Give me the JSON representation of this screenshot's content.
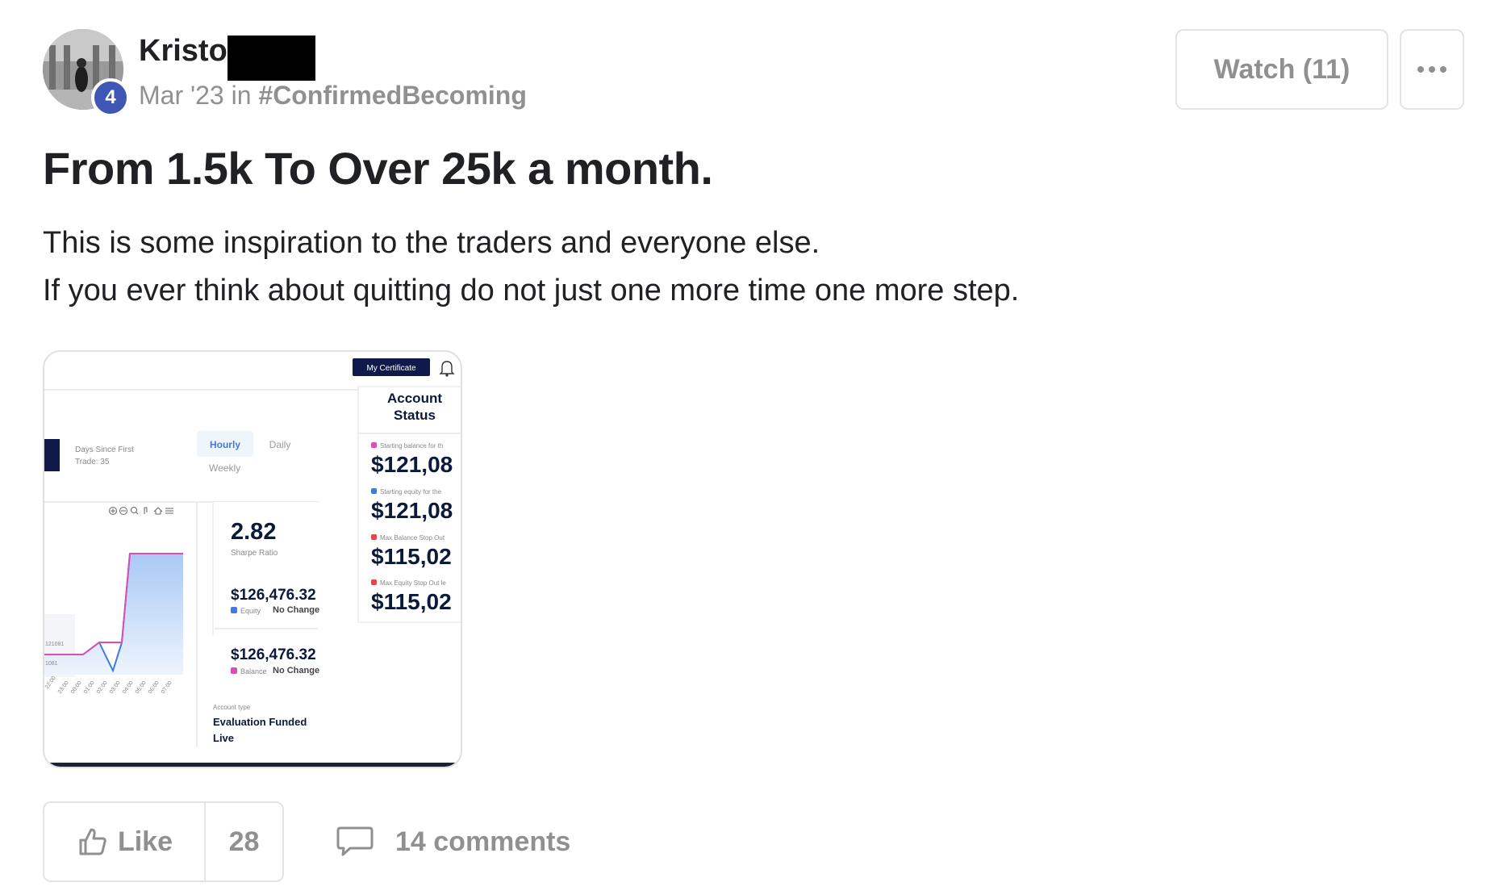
{
  "author": {
    "name": "Kristo",
    "level": "4",
    "date": "Mar '23",
    "in_word": "in",
    "category": "#ConfirmedBecoming"
  },
  "header_actions": {
    "watch_label": "Watch (11)",
    "more_icon": "ellipsis-icon"
  },
  "post": {
    "title": "From 1.5k To Over 25k a month.",
    "body": [
      "This is some inspiration to the traders and everyone else.",
      "If you ever think about quitting do not just one more time one more step."
    ]
  },
  "attachment": {
    "top_button": "My Certificate",
    "days_since": "Days Since First",
    "trade": "Trade: 35",
    "tabs": [
      "Hourly",
      "Daily",
      "Weekly"
    ],
    "account_status_title": [
      "Account",
      "Status"
    ],
    "status_items": [
      {
        "label": "Starting balance for th",
        "value": "$121,08",
        "color": "#d94fb8"
      },
      {
        "label": "Starting equity for the",
        "value": "$121,08",
        "color": "#3f7ae0"
      },
      {
        "label": "Max Balance Stop Out",
        "value": "$115,02",
        "color": "#e24848"
      },
      {
        "label": "Max Equity Stop Out le",
        "value": "$115,02",
        "color": "#e24848"
      }
    ],
    "sharpe_value": "2.82",
    "sharpe_label": "Sharpe Ratio",
    "equity_value": "$126,476.32",
    "equity_label": "Equity",
    "equity_change": "No Change",
    "balance_value": "$126,476.32",
    "balance_label": "Balance",
    "balance_change": "No Change",
    "account_type_label": "Account type",
    "account_type_value": [
      "Evaluation Funded",
      "Live"
    ],
    "y_ticks": [
      "121081",
      "1081"
    ],
    "x_ticks": [
      "22:00",
      "23:00",
      "00:00",
      "01:00",
      "02:00",
      "03:00",
      "04:00",
      "05:00",
      "06:00",
      "07:00"
    ]
  },
  "footer": {
    "like_label": "Like",
    "like_count": "28",
    "comments_label": "14 comments"
  },
  "colors": {
    "muted": "#909090",
    "badge": "#3e57b4",
    "navy": "#0f1a4a"
  }
}
